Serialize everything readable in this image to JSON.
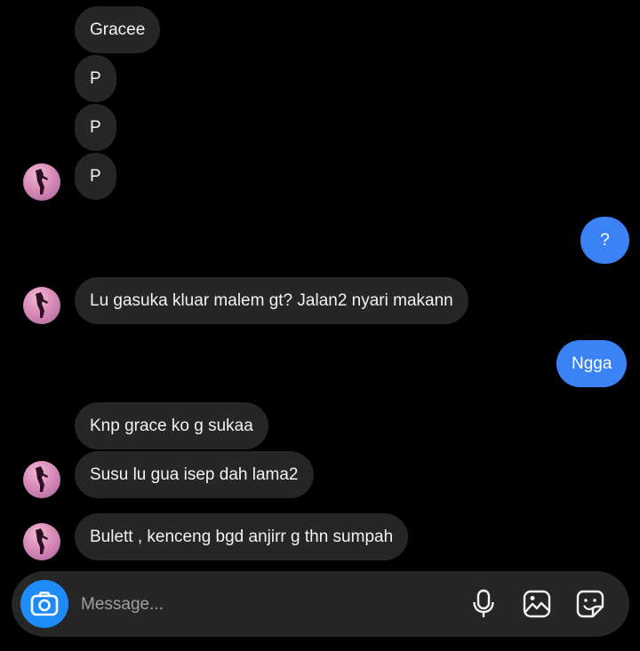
{
  "messages": [
    {
      "text": "Gracee"
    },
    {
      "text": "P"
    },
    {
      "text": "P"
    },
    {
      "text": "P"
    },
    {
      "text": "?"
    },
    {
      "text": "Lu gasuka kluar malem gt? Jalan2 nyari makann"
    },
    {
      "text": "Ngga"
    },
    {
      "text": "Knp grace ko g sukaa"
    },
    {
      "text": "Susu lu gua isep dah lama2"
    },
    {
      "text": "Bulett , kenceng bgd anjirr g thn sumpah"
    }
  ],
  "composer": {
    "placeholder": "Message...",
    "icons": [
      "camera-icon",
      "microphone-icon",
      "gallery-icon",
      "sticker-icon"
    ]
  },
  "colors": {
    "background": "#000000",
    "incoming_bubble": "#262626",
    "outgoing_bubble": "#3b82f6",
    "camera_button": "#1d8cf8"
  }
}
